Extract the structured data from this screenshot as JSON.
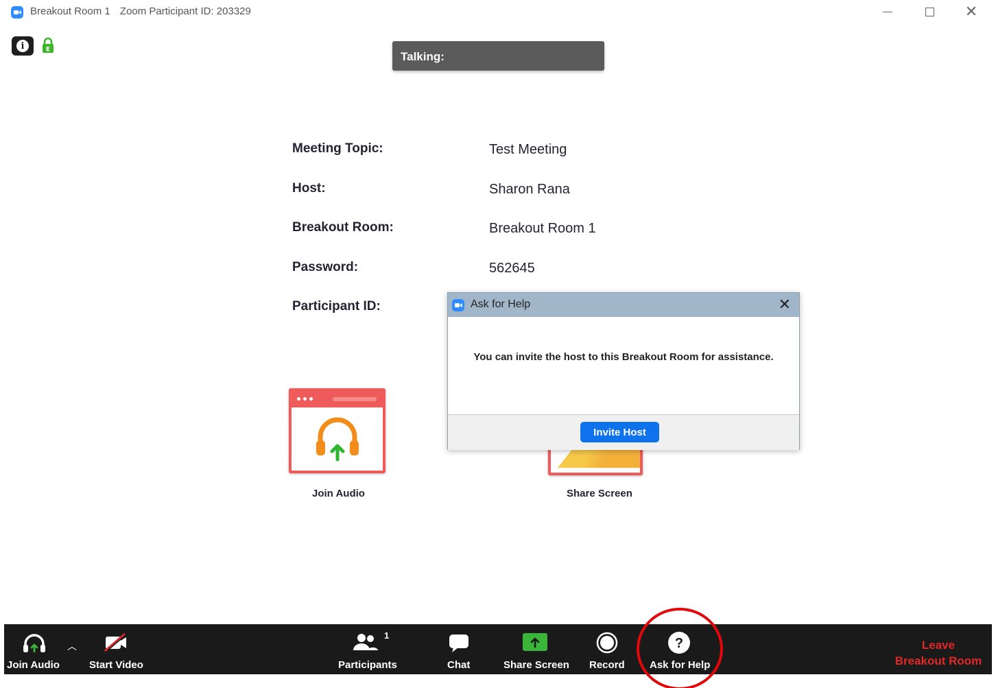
{
  "window": {
    "title": "Breakout Room 1",
    "subtitle": "Zoom Participant ID: 203329"
  },
  "talking_label": "Talking:",
  "meeting_info": {
    "topic_label": "Meeting Topic:",
    "topic_value": "Test Meeting",
    "host_label": "Host:",
    "host_value": "Sharon Rana",
    "room_label": "Breakout Room:",
    "room_value": "Breakout Room 1",
    "password_label": "Password:",
    "password_value": "562645",
    "participant_label": "Participant ID:"
  },
  "tiles": {
    "join_audio_label": "Join Audio",
    "share_screen_label": "Share Screen"
  },
  "dialog": {
    "title": "Ask for Help",
    "close": "✕",
    "message": "You can invite the host to this Breakout Room for assistance.",
    "invite_button": "Invite Host"
  },
  "toolbar": {
    "join_audio": "Join Audio",
    "start_video": "Start Video",
    "participants": "Participants",
    "participants_count": "1",
    "chat": "Chat",
    "share_screen": "Share Screen",
    "record": "Record",
    "ask_for_help": "Ask for Help",
    "leave_line1": "Leave",
    "leave_line2": "Breakout Room"
  },
  "colors": {
    "zoom_blue": "#2d8cff",
    "button_blue": "#0e72ed",
    "leave_red": "#e02828",
    "share_green": "#3ab53a",
    "tile_red": "#ef5b5b",
    "headphone_orange": "#f28c1a",
    "annotation_red": "#e0080b"
  }
}
